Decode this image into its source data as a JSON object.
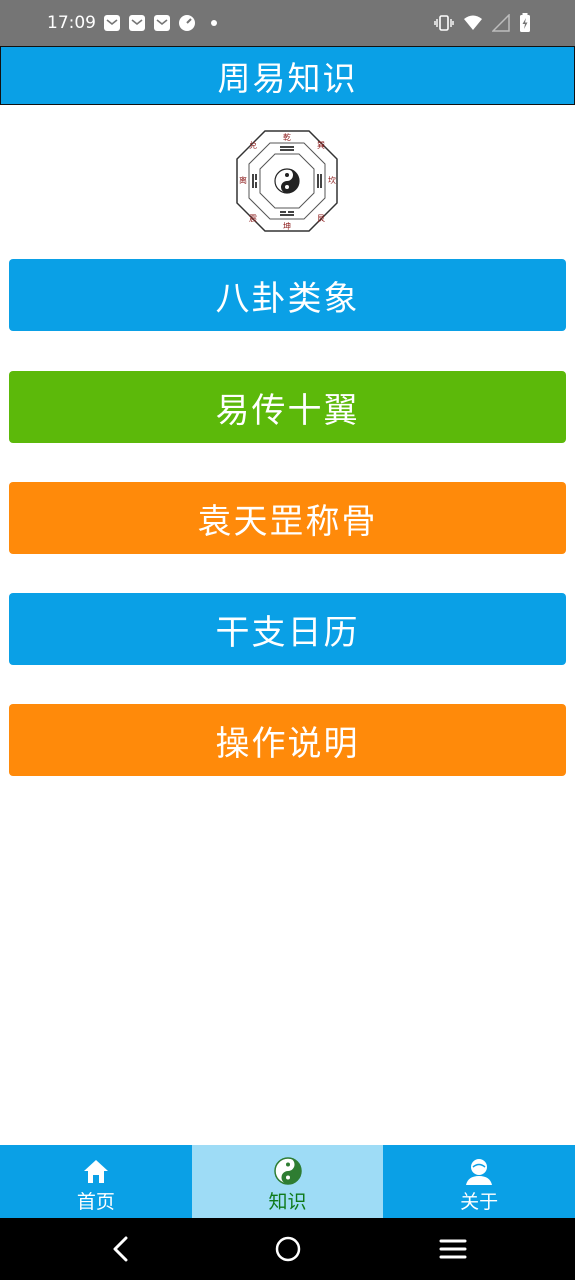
{
  "status_bar": {
    "time": "17:09",
    "left_icons": [
      "mail-icon",
      "mail-icon",
      "mail-icon",
      "gauge-icon",
      "dot-icon"
    ],
    "right_icons": [
      "vibrate-icon",
      "wifi-icon",
      "signal-icon",
      "battery-charging-icon"
    ]
  },
  "header": {
    "title": "周易知识"
  },
  "menu": {
    "items": [
      {
        "label": "八卦类象",
        "color": "#0aa0e6"
      },
      {
        "label": "易传十翼",
        "color": "#5cb90a"
      },
      {
        "label": "袁天罡称骨",
        "color": "#ff8a0a"
      },
      {
        "label": "干支日历",
        "color": "#0aa0e6"
      },
      {
        "label": "操作说明",
        "color": "#ff8a0a"
      }
    ]
  },
  "bottom_nav": {
    "items": [
      {
        "label": "首页",
        "icon": "home-icon",
        "active": false
      },
      {
        "label": "知识",
        "icon": "yin-yang-icon",
        "active": true
      },
      {
        "label": "关于",
        "icon": "user-icon",
        "active": false
      }
    ]
  },
  "system_nav": {
    "buttons": [
      "back-icon",
      "home-circle-icon",
      "recents-icon"
    ]
  }
}
